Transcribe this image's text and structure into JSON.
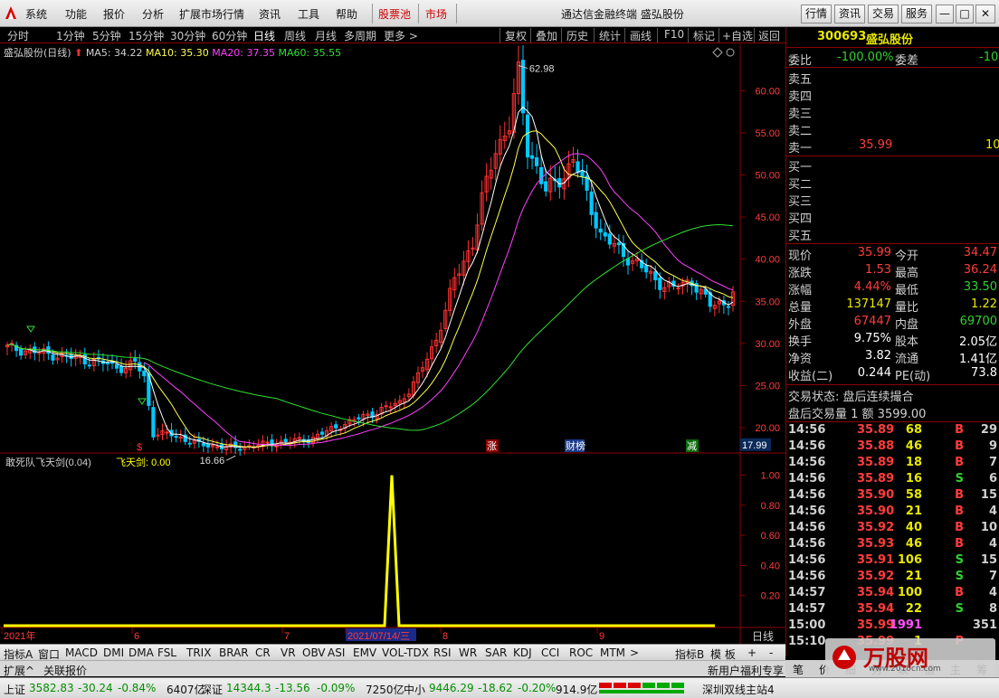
{
  "menu": {
    "items": [
      "系统",
      "功能",
      "报价",
      "分析",
      "扩展市场行情",
      "资讯",
      "工具",
      "帮助"
    ],
    "hot1": "股票池",
    "hot2": "市场",
    "title": "通达信金融终端  盛弘股份",
    "right_buttons": [
      "行情",
      "资讯",
      "交易",
      "服务"
    ]
  },
  "toolbar": {
    "periods": [
      "分时",
      "1分钟",
      "5分钟",
      "15分钟",
      "30分钟",
      "60分钟",
      "日线",
      "周线",
      "月线",
      "多周期",
      "更多 >"
    ],
    "actions": [
      "复权",
      "叠加",
      "历史",
      "统计",
      "画线",
      "F10",
      "标记",
      "+自选",
      "返回"
    ]
  },
  "ma": {
    "title": "盛弘股份(日线)",
    "ma5": "MA5: 34.22",
    "ma10": "MA10: 35.30",
    "ma20": "MA20: 37.35",
    "ma60": "MA60: 35.55"
  },
  "yaxis": {
    "ticks": [
      "60.00",
      "55.00",
      "50.00",
      "45.00",
      "40.00",
      "35.00",
      "30.00",
      "25.00",
      "20.00"
    ],
    "current": "17.99"
  },
  "annotations": {
    "high": "62.98",
    "low": "16.66",
    "zhang": "涨",
    "jie": "解",
    "cai": "财榜",
    "jian": "减",
    "dollar": "$"
  },
  "indicator": {
    "title": "敢死队飞天剑(0.04)",
    "line": "飞天剑: 0.00",
    "ticks": [
      "1.00",
      "0.80",
      "0.60",
      "0.40",
      "0.20"
    ]
  },
  "xaxis": {
    "labels": [
      "2021年",
      "6",
      "7",
      "2021/07/14/三",
      "8",
      "9"
    ],
    "period": "日线"
  },
  "bottom_tabs": [
    "指标A",
    "窗口",
    "MACD",
    "DMI",
    "DMA",
    "FSL",
    "TRIX",
    "BRAR",
    "CR",
    "VR",
    "OBV",
    "ASI",
    "EMV",
    "VOL-TDX",
    "RSI",
    "WR",
    "SAR",
    "KDJ",
    "CCI",
    "ROC",
    "MTM",
    ">",
    "指标B",
    "模 板",
    "+",
    "-"
  ],
  "ext_bar": {
    "left": [
      "扩展^",
      "关联报价"
    ],
    "right": "新用户福利专享"
  },
  "quote": {
    "code": "300693",
    "name": "盛弘股份",
    "weibi_label": "委比",
    "weibi": "-100.00%",
    "weicha_label": "委差",
    "weicha": "-10",
    "sells": [
      "卖五",
      "卖四",
      "卖三",
      "卖二",
      "卖一"
    ],
    "sell1_price": "35.99",
    "sell1_vol": "10",
    "buys": [
      "买一",
      "买二",
      "买三",
      "买四",
      "买五"
    ],
    "stats": [
      {
        "l1": "现价",
        "v1": "35.99",
        "l2": "今开",
        "v2": "34.47"
      },
      {
        "l1": "涨跌",
        "v1": "1.53",
        "l2": "最高",
        "v2": "36.24"
      },
      {
        "l1": "涨幅",
        "v1": "4.44%",
        "l2": "最低",
        "v2": "33.50"
      },
      {
        "l1": "总量",
        "v1": "137147",
        "l2": "量比",
        "v2": "1.22"
      },
      {
        "l1": "外盘",
        "v1": "67447",
        "l2": "内盘",
        "v2": "69700"
      },
      {
        "l1": "换手",
        "v1": "9.75%",
        "l2": "股本",
        "v2": "2.05亿"
      },
      {
        "l1": "净资",
        "v1": "3.82",
        "l2": "流通",
        "v2": "1.41亿"
      },
      {
        "l1": "收益(二)",
        "v1": "0.244",
        "l2": "PE(动)",
        "v2": "73.8"
      }
    ],
    "trade_status": "交易状态: 盘后连续撮合",
    "after_trade": "盘后交易量 1 额  3599.00",
    "ticks": [
      {
        "t": "14:56",
        "p": "35.89",
        "v": "68",
        "s": "B",
        "n": "29"
      },
      {
        "t": "14:56",
        "p": "35.88",
        "v": "46",
        "s": "B",
        "n": "9"
      },
      {
        "t": "14:56",
        "p": "35.89",
        "v": "18",
        "s": "B",
        "n": "7"
      },
      {
        "t": "14:56",
        "p": "35.89",
        "v": "16",
        "s": "S",
        "n": "6"
      },
      {
        "t": "14:56",
        "p": "35.90",
        "v": "58",
        "s": "B",
        "n": "15"
      },
      {
        "t": "14:56",
        "p": "35.90",
        "v": "21",
        "s": "B",
        "n": "4"
      },
      {
        "t": "14:56",
        "p": "35.92",
        "v": "40",
        "s": "B",
        "n": "10"
      },
      {
        "t": "14:56",
        "p": "35.93",
        "v": "46",
        "s": "B",
        "n": "4"
      },
      {
        "t": "14:56",
        "p": "35.91",
        "v": "106",
        "s": "S",
        "n": "15"
      },
      {
        "t": "14:56",
        "p": "35.92",
        "v": "21",
        "s": "S",
        "n": "7"
      },
      {
        "t": "14:57",
        "p": "35.94",
        "v": "100",
        "s": "B",
        "n": "4"
      },
      {
        "t": "14:57",
        "p": "35.94",
        "v": "22",
        "s": "S",
        "n": "8"
      },
      {
        "t": "15:00",
        "p": "35.99",
        "v": "1991",
        "s": "",
        "n": "351"
      },
      {
        "t": "15:10",
        "p": "35.99",
        "v": "1",
        "s": "P",
        "n": ""
      }
    ],
    "right_tabs": [
      "笔",
      "价",
      "细",
      "势",
      "联",
      "值",
      "主",
      "筹"
    ]
  },
  "status": {
    "sh": "上证",
    "sh_v": "3582.83",
    "sh_c": "-30.24",
    "sh_p": "-0.84%",
    "sh_a": "6407亿",
    "sz": "深证",
    "sz_v": "14344.3",
    "sz_c": "-13.56",
    "sz_p": "-0.09%",
    "sz_a": "7250亿",
    "zx": "中小",
    "zx_v": "9446.29",
    "zx_c": "-18.62",
    "zx_p": "-0.20%",
    "zx_a": "914.9亿",
    "station": "深圳双线主站4"
  },
  "watermark": {
    "text": "万股网",
    "sub": "www.2010cn.com"
  },
  "chart_data": {
    "type": "candlestick",
    "title": "盛弘股份(日线)",
    "ylim": [
      17.0,
      64.0
    ],
    "ma_values": {
      "MA5": 34.22,
      "MA10": 35.3,
      "MA20": 37.35,
      "MA60": 35.55
    },
    "high": 62.98,
    "low": 16.66,
    "last": 35.99,
    "indicator": {
      "name": "敢死队飞天剑",
      "param": 0.04,
      "value": 0.0,
      "ylim": [
        0,
        1.1
      ],
      "spike": {
        "date": "2021/07/14",
        "value": 1.0
      }
    },
    "colors": {
      "up": "#ff3030",
      "down": "#00c8ff",
      "ma5": "#ffffff",
      "ma10": "#ffff50",
      "ma20": "#ff40ff",
      "ma60": "#30e030"
    }
  }
}
